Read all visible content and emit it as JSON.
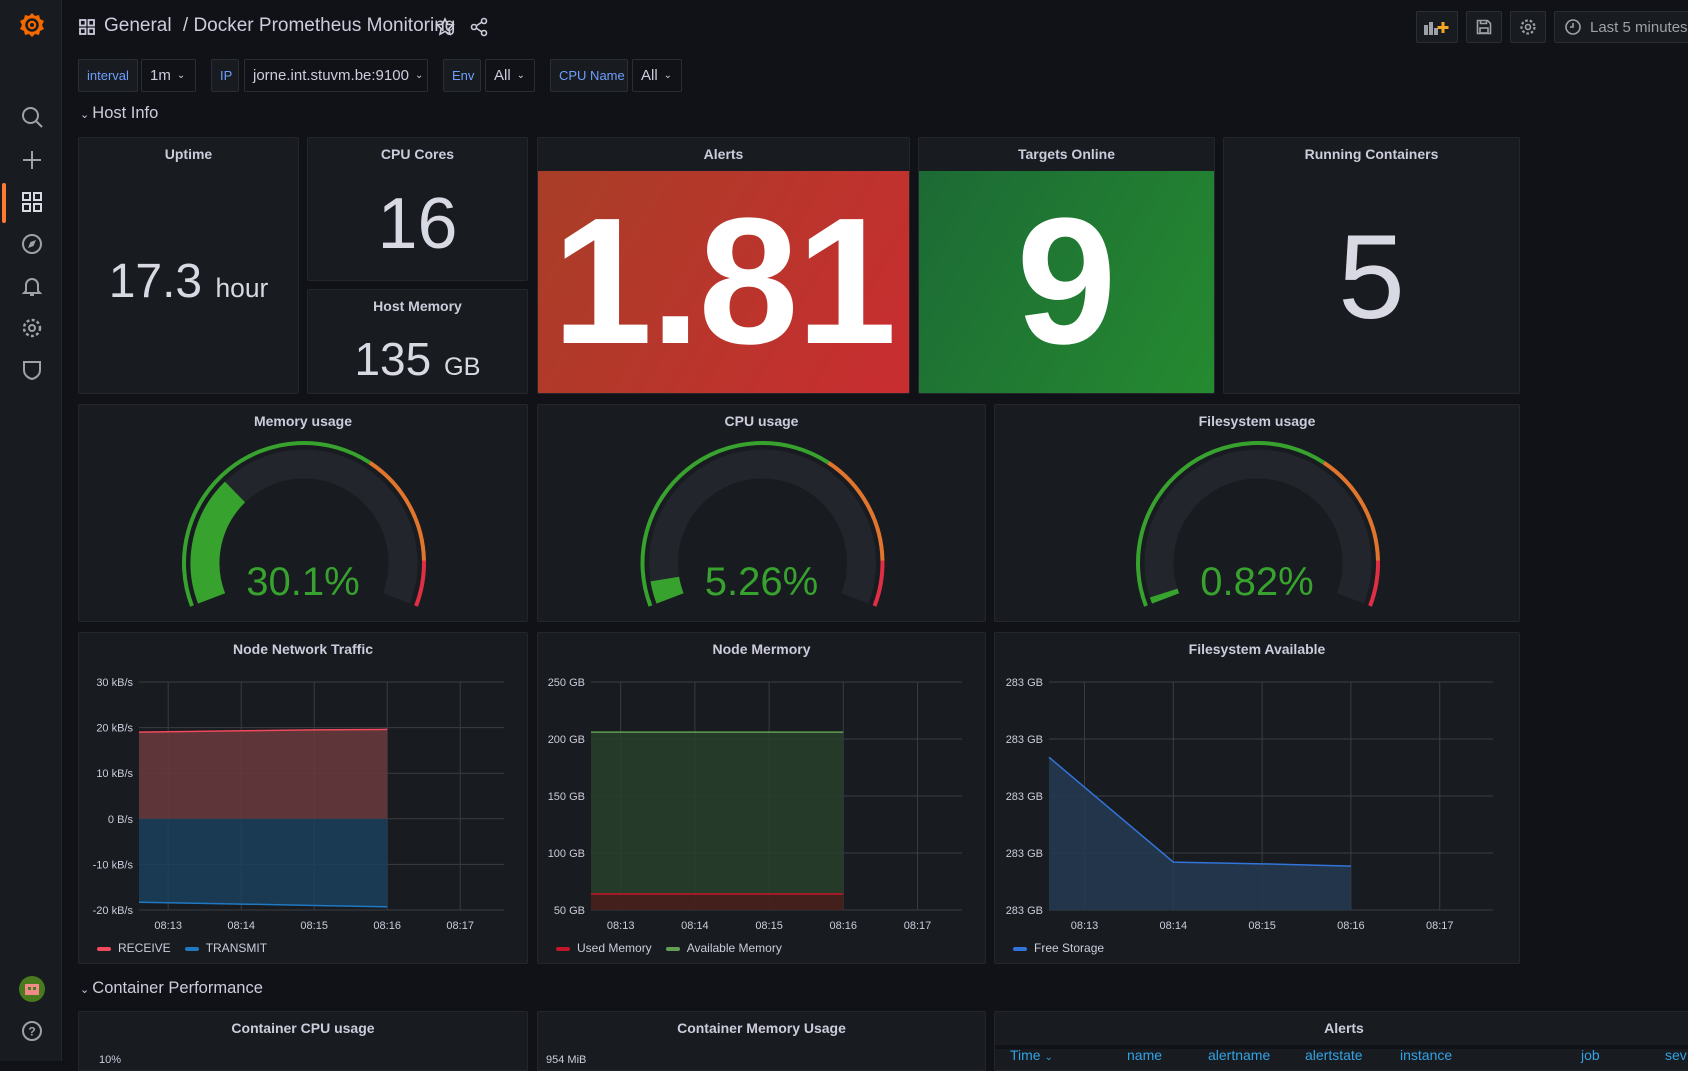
{
  "breadcrumb": {
    "folder": "General",
    "title": "/ Docker Prometheus Monitoring"
  },
  "toolbar": {
    "time_range": "Last 5 minutes"
  },
  "variables": [
    {
      "label": "interval",
      "value": "1m"
    },
    {
      "label": "IP",
      "value": "jorne.int.stuvm.be:9100"
    },
    {
      "label": "Env",
      "value": "All"
    },
    {
      "label": "CPU Name",
      "value": "All"
    }
  ],
  "rows": {
    "host_info": "Host Info",
    "container_performance": "Container Performance"
  },
  "stats": {
    "uptime": {
      "title": "Uptime",
      "value": "17.3",
      "unit": "hour"
    },
    "cpu_cores": {
      "title": "CPU Cores",
      "value": "16"
    },
    "host_memory": {
      "title": "Host Memory",
      "value": "135",
      "unit": "GB"
    },
    "alerts": {
      "title": "Alerts",
      "value": "1.81",
      "color": "#c4302c"
    },
    "targets": {
      "title": "Targets Online",
      "value": "9",
      "color": "#1f7a33"
    },
    "containers": {
      "title": "Running Containers",
      "value": "5"
    }
  },
  "gauges": [
    {
      "title": "Memory usage",
      "value": 30.1,
      "display": "30.1%",
      "thresholds": {
        "orange": 65,
        "red": 90
      }
    },
    {
      "title": "CPU usage",
      "value": 5.26,
      "display": "5.26%",
      "thresholds": {
        "orange": 65,
        "red": 90
      }
    },
    {
      "title": "Filesystem usage",
      "value": 0.82,
      "display": "0.82%",
      "thresholds": {
        "orange": 65,
        "red": 90
      }
    }
  ],
  "colors": {
    "green": "#37a22e",
    "orange": "#e0752d",
    "red": "#e02f44",
    "track": "#22252b"
  },
  "chart_data": [
    {
      "type": "area",
      "title": "Node Network Traffic",
      "x_range": [
        "08:12:36",
        "08:17:36"
      ],
      "x_ticks": [
        "08:13",
        "08:14",
        "08:15",
        "08:16",
        "08:17"
      ],
      "ylim": [
        -20,
        30
      ],
      "y_ticks": [
        {
          "v": 30,
          "l": "30 kB/s"
        },
        {
          "v": 20,
          "l": "20 kB/s"
        },
        {
          "v": 10,
          "l": "10 kB/s"
        },
        {
          "v": 0,
          "l": "0 B/s"
        },
        {
          "v": -10,
          "l": "-10 kB/s"
        },
        {
          "v": -20,
          "l": "-20 kB/s"
        }
      ],
      "grid": true,
      "legend": "bottom-left",
      "series": [
        {
          "name": "RECEIVE",
          "color": "#f2495c",
          "fill": "#6b3a3d",
          "x": [
            "08:12:36",
            "08:13",
            "08:14",
            "08:15",
            "08:16"
          ],
          "y": [
            19.0,
            19.1,
            19.3,
            19.5,
            19.6
          ]
        },
        {
          "name": "TRANSMIT",
          "color": "#1f78c1",
          "fill": "#1b3f5e",
          "x": [
            "08:12:36",
            "08:13",
            "08:14",
            "08:15",
            "08:16"
          ],
          "y": [
            -18.3,
            -18.4,
            -18.7,
            -19.0,
            -19.3
          ]
        }
      ]
    },
    {
      "type": "area",
      "title": "Node Mermory",
      "x_range": [
        "08:12:36",
        "08:17:36"
      ],
      "x_ticks": [
        "08:13",
        "08:14",
        "08:15",
        "08:16",
        "08:17"
      ],
      "ylim": [
        50,
        250
      ],
      "y_ticks": [
        {
          "v": 250,
          "l": "250 GB"
        },
        {
          "v": 200,
          "l": "200 GB"
        },
        {
          "v": 150,
          "l": "150 GB"
        },
        {
          "v": 100,
          "l": "100 GB"
        },
        {
          "v": 50,
          "l": "50 GB"
        }
      ],
      "grid": true,
      "legend": "bottom-left",
      "series": [
        {
          "name": "Used Memory",
          "color": "#c4162a",
          "fill": "#4a1c1b",
          "x": [
            "08:12:36",
            "08:13",
            "08:14",
            "08:15",
            "08:16"
          ],
          "y": [
            64,
            64,
            64,
            64,
            64
          ]
        },
        {
          "name": "Available Memory",
          "color": "#629e51",
          "fill": "#29402d",
          "x": [
            "08:12:36",
            "08:13",
            "08:14",
            "08:15",
            "08:16"
          ],
          "y": [
            206,
            206,
            206,
            206,
            206
          ]
        }
      ]
    },
    {
      "type": "area",
      "title": "Filesystem Available",
      "x_range": [
        "08:12:36",
        "08:17:36"
      ],
      "x_ticks": [
        "08:13",
        "08:14",
        "08:15",
        "08:16",
        "08:17"
      ],
      "ylim": [
        283.0,
        283.04
      ],
      "y_ticks": [
        {
          "v": 283.04,
          "l": "283 GB"
        },
        {
          "v": 283.03,
          "l": "283 GB"
        },
        {
          "v": 283.02,
          "l": "283 GB"
        },
        {
          "v": 283.01,
          "l": "283 GB"
        },
        {
          "v": 283.0,
          "l": "283 GB"
        }
      ],
      "grid": true,
      "legend": "bottom-left",
      "series": [
        {
          "name": "Free Storage",
          "color": "#3274d9",
          "fill": "#243a52",
          "x": [
            "08:12:36",
            "08:14",
            "08:15",
            "08:16"
          ],
          "y": [
            283.0268,
            283.0084,
            283.0081,
            283.0077
          ]
        }
      ]
    }
  ],
  "bottom_panels": {
    "cpu": {
      "title": "Container CPU usage",
      "first_tick": "10%"
    },
    "memory": {
      "title": "Container Memory Usage",
      "first_tick": "954 MiB"
    },
    "alerts": {
      "title": "Alerts",
      "columns": [
        "Time",
        "name",
        "alertname",
        "alertstate",
        "instance",
        "job",
        "sev"
      ]
    }
  }
}
